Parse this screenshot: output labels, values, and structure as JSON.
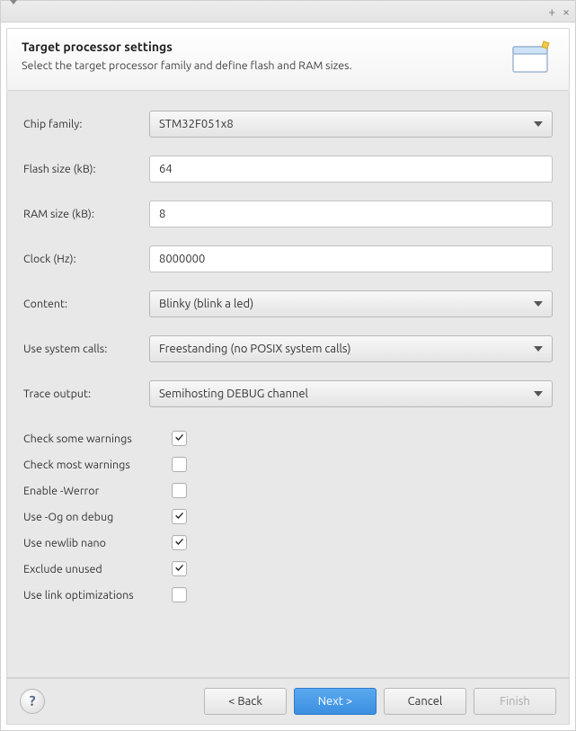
{
  "header": {
    "title": "Target processor settings",
    "description": "Select the target processor family and define flash and RAM sizes."
  },
  "fields": {
    "chip_family": {
      "label": "Chip family:",
      "value": "STM32F051x8"
    },
    "flash_size": {
      "label": "Flash size (kB):",
      "value": "64"
    },
    "ram_size": {
      "label": "RAM size (kB):",
      "value": "8"
    },
    "clock": {
      "label": "Clock (Hz):",
      "value": "8000000"
    },
    "content": {
      "label": "Content:",
      "value": "Blinky (blink a led)"
    },
    "syscalls": {
      "label": "Use system calls:",
      "value": "Freestanding (no POSIX system calls)"
    },
    "trace": {
      "label": "Trace output:",
      "value": "Semihosting DEBUG channel"
    }
  },
  "checks": {
    "some_warnings": {
      "label": "Check some warnings",
      "checked": true
    },
    "most_warnings": {
      "label": "Check most warnings",
      "checked": false
    },
    "werror": {
      "label": "Enable -Werror",
      "checked": false
    },
    "og_debug": {
      "label": "Use -Og on debug",
      "checked": true
    },
    "newlib_nano": {
      "label": "Use newlib nano",
      "checked": true
    },
    "exclude_unused": {
      "label": "Exclude unused",
      "checked": true
    },
    "link_opt": {
      "label": "Use link optimizations",
      "checked": false
    }
  },
  "footer": {
    "back": "< Back",
    "next": "Next >",
    "cancel": "Cancel",
    "finish": "Finish"
  }
}
